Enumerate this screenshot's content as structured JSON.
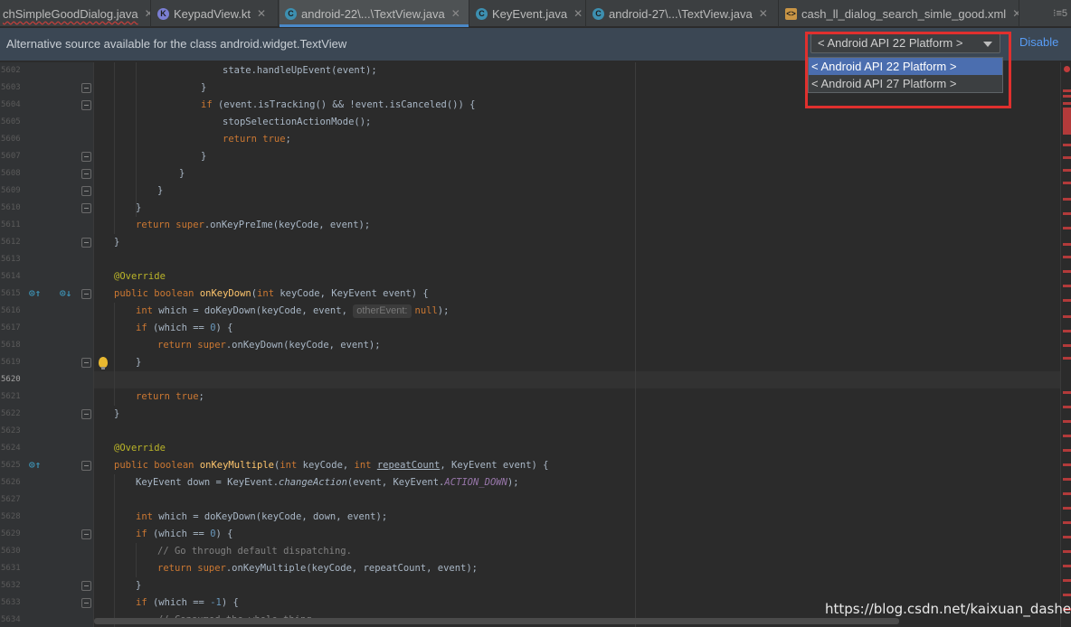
{
  "tabs": [
    {
      "label": "chSimpleGoodDialog.java",
      "icon": "java-class-icon"
    },
    {
      "label": "KeypadView.kt",
      "icon": "kotlin-file-icon"
    },
    {
      "label": "android-22\\...\\TextView.java",
      "icon": "java-class-icon"
    },
    {
      "label": "KeyEvent.java",
      "icon": "java-class-icon"
    },
    {
      "label": "android-27\\...\\TextView.java",
      "icon": "java-class-icon"
    },
    {
      "label": "cash_ll_dialog_search_simle_good.xml",
      "icon": "xml-file-icon"
    }
  ],
  "tab_overflow": "⁝≡5",
  "close_glyph": "✕",
  "notification": {
    "message": "Alternative source available for the class android.widget.TextView",
    "selected_source": "< Android API 22 Platform >",
    "disable_label": "Disable"
  },
  "dropdown_options": [
    "< Android API 22 Platform >",
    "< Android API 27 Platform >"
  ],
  "line_numbers": [
    "5602",
    "5603",
    "5604",
    "5605",
    "5606",
    "5607",
    "5608",
    "5609",
    "5610",
    "5611",
    "5612",
    "5613",
    "5614",
    "5615",
    "5616",
    "5617",
    "5618",
    "5619",
    "5620",
    "5621",
    "5622",
    "5623",
    "5624",
    "5625",
    "5626",
    "5627",
    "5628",
    "5629",
    "5630",
    "5631",
    "5632",
    "5633",
    "5634"
  ],
  "code": {
    "l5602": {
      "a": "state",
      "b": ".handleUpEvent(event);"
    },
    "l5603": "}",
    "l5604": {
      "kw": "if",
      "b": " (event.isTracking() && !event.isCanceled()) {"
    },
    "l5605": "stopSelectionActionMode();",
    "l5606": {
      "kw": "return true",
      "b": ";"
    },
    "l5607": "}",
    "l5608": "}",
    "l5609": "}",
    "l5610": "}",
    "l5611": {
      "kw": "return super",
      "b": ".onKeyPreIme(keyCode, event);"
    },
    "l5612": "}",
    "l5614": "@Override",
    "l5615": {
      "kw": "public boolean ",
      "fn": "onKeyDown",
      "p1": "(",
      "kw2": "int",
      "b": " keyCode, KeyEvent event) {"
    },
    "l5616": {
      "kw": "int",
      "b": " which = doKeyDown(keyCode, event, ",
      "hint": "otherEvent:",
      "kw2": "null",
      "c": ");"
    },
    "l5617": {
      "kw": "if",
      "b": " (which == ",
      "num": "0",
      "c": ") {"
    },
    "l5618": {
      "kw": "return super",
      "b": ".onKeyDown(keyCode, event);"
    },
    "l5619": "}",
    "l5621": {
      "kw": "return true",
      "b": ";"
    },
    "l5622": "}",
    "l5624": "@Override",
    "l5625": {
      "kw": "public boolean ",
      "fn": "onKeyMultiple",
      "p1": "(",
      "kw2": "int",
      "b": " keyCode, ",
      "kw3": "int",
      "ul": "repeatCount",
      "c": ", KeyEvent event) {"
    },
    "l5626": {
      "a": "KeyEvent down = KeyEvent.",
      "it1": "changeAction",
      "b": "(event, KeyEvent.",
      "it2": "ACTION_DOWN",
      "c": ");"
    },
    "l5628": {
      "kw": "int",
      "b": " which = doKeyDown(keyCode, down, event);"
    },
    "l5629": {
      "kw": "if",
      "b": " (which == ",
      "num": "0",
      "c": ") {"
    },
    "l5630": "// Go through default dispatching.",
    "l5631": {
      "kw": "return super",
      "b": ".onKeyMultiple(keyCode, repeatCount, event);"
    },
    "l5632": "}",
    "l5633": {
      "kw": "if",
      "b": " (which == ",
      "num": "-1",
      "c": ") {"
    },
    "l5634": "// Consumed the whole thing"
  },
  "watermark": "https://blog.csdn.net/kaixuan_dashen",
  "colors": {
    "keyword": "#cc7832",
    "number": "#6897bb",
    "annotation": "#bbb529",
    "method": "#ffc66d",
    "static_field": "#9876aa",
    "comment": "#808080",
    "selection_highlight": "#e0302e",
    "link": "#589df6"
  }
}
